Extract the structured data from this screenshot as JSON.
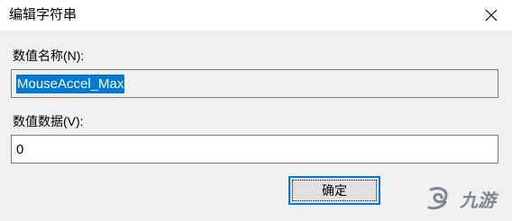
{
  "window": {
    "title": "编辑字符串",
    "close_icon": "close-icon"
  },
  "value_name": {
    "label": "数值名称(N):",
    "value": "MouseAccel_Max"
  },
  "value_data": {
    "label": "数值数据(V):",
    "value": "0"
  },
  "buttons": {
    "ok_label": "确定"
  },
  "watermark": {
    "logo_icon": "nine-game-logo-icon",
    "text": "九游"
  },
  "colors": {
    "selection": "#0078d7",
    "focus_border": "#0078d7",
    "dialog_background": "#f0f0f0",
    "titlebar_background": "#ffffff"
  }
}
